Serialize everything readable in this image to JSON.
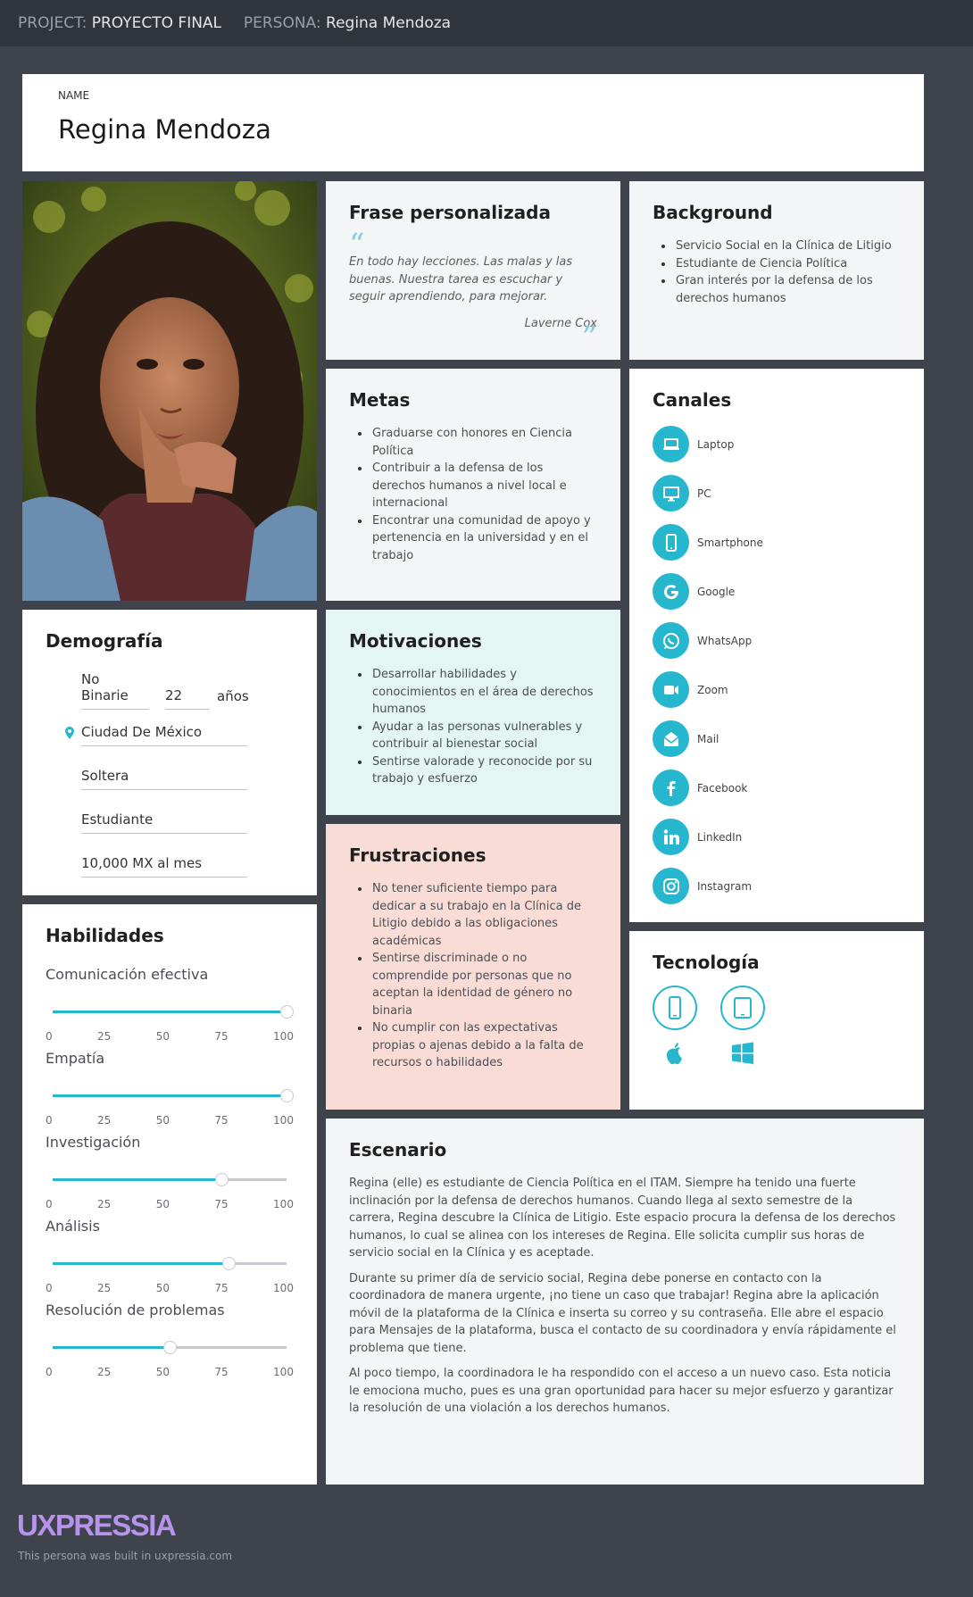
{
  "header": {
    "project_label": "PROJECT:",
    "project_value": "PROYECTO FINAL",
    "persona_label": "PERSONA:",
    "persona_value": "Regina Mendoza"
  },
  "name_card": {
    "label": "NAME",
    "name": "Regina Mendoza"
  },
  "quote_card": {
    "title": "Frase personalizada",
    "text": "En todo hay lecciones. Las malas y las buenas. Nuestra tarea es escuchar y seguir aprendiendo, para mejorar.",
    "author": "Laverne Cox"
  },
  "background": {
    "title": "Background",
    "items": [
      "Servicio Social en la Clínica de Litigio",
      "Estudiante de Ciencia Política",
      "Gran interés por la defensa de los derechos humanos"
    ]
  },
  "goals": {
    "title": "Metas",
    "items": [
      "Graduarse con honores en Ciencia Política",
      "Contribuir a la defensa de los derechos humanos a nivel local e internacional",
      "Encontrar una comunidad de apoyo y pertenencia en la universidad y en el trabajo"
    ]
  },
  "channels": {
    "title": "Canales",
    "items": [
      {
        "label": "Laptop",
        "icon": "laptop-icon"
      },
      {
        "label": "PC",
        "icon": "desktop-icon"
      },
      {
        "label": "Smartphone",
        "icon": "smartphone-icon"
      },
      {
        "label": "Google",
        "icon": "google-icon"
      },
      {
        "label": "WhatsApp",
        "icon": "whatsapp-icon"
      },
      {
        "label": "Zoom",
        "icon": "zoom-icon"
      },
      {
        "label": "Mail",
        "icon": "mail-icon"
      },
      {
        "label": "Facebook",
        "icon": "facebook-icon"
      },
      {
        "label": "LinkedIn",
        "icon": "linkedin-icon"
      },
      {
        "label": "Instagram",
        "icon": "instagram-icon"
      }
    ]
  },
  "demographics": {
    "title": "Demografía",
    "gender": "No Binarie",
    "age": "22",
    "age_unit": "años",
    "location": "Ciudad De México",
    "status": "Soltera",
    "occupation": "Estudiante",
    "income": "10,000 MX al mes"
  },
  "motivations": {
    "title": "Motivaciones",
    "items": [
      "Desarrollar habilidades y conocimientos en el área de derechos humanos",
      "Ayudar a las personas vulnerables y contribuir al bienestar social",
      "Sentirse valorade y reconocide por su trabajo y esfuerzo"
    ]
  },
  "frustrations": {
    "title": "Frustraciones",
    "items": [
      "No tener suficiente tiempo para dedicar a su trabajo en la Clínica de Litigio debido a las obligaciones académicas",
      "Sentirse discriminade o no comprendide por personas que no aceptan la identidad de género no binaria",
      "No cumplir con las expectativas propias o ajenas debido a la falta de recursos o habilidades"
    ]
  },
  "skills": {
    "title": "Habilidades",
    "tick_labels": [
      "0",
      "25",
      "50",
      "75",
      "100"
    ],
    "items": [
      {
        "name": "Comunicación efectiva",
        "value": 100
      },
      {
        "name": "Empatía",
        "value": 100
      },
      {
        "name": "Investigación",
        "value": 72
      },
      {
        "name": "Análisis",
        "value": 75
      },
      {
        "name": "Resolución de problemas",
        "value": 50
      }
    ]
  },
  "technology": {
    "title": "Tecnología",
    "items": [
      {
        "device": "smartphone-icon",
        "os": "apple-icon"
      },
      {
        "device": "tablet-icon",
        "os": "windows-icon"
      }
    ]
  },
  "scenario": {
    "title": "Escenario",
    "paragraphs": [
      "Regina (elle) es estudiante de Ciencia Política en el ITAM. Siempre ha tenido una fuerte inclinación por la defensa de derechos humanos. Cuando llega al sexto semestre de la carrera, Regina descubre la Clínica de Litigio. Este espacio procura la defensa de los derechos humanos, lo cual se alinea con los intereses de Regina. Elle solicita cumplir sus horas de servicio social en la Clínica y es aceptade.",
      "Durante su primer día de servicio social, Regina debe ponerse en contacto con la coordinadora de manera urgente, ¡no tiene un caso que trabajar! Regina abre la aplicación móvil de la plataforma de la Clínica e inserta su correo y su contraseña. Elle abre el espacio para Mensajes de la plataforma, busca el contacto de su coordinadora y envía rápidamente el problema que tiene.",
      "Al poco tiempo, la coordinadora le ha respondido con el acceso a un nuevo caso. Esta noticia le emociona mucho, pues es una gran oportunidad para hacer su mejor esfuerzo y garantizar la resolución de una violación a los derechos humanos."
    ]
  },
  "footer": {
    "logo": "UXPRESSIA",
    "built_by": "This persona was built in uxpressia.com"
  },
  "colors": {
    "accent": "#26b6cd",
    "motivations_bg": "#e3f6f3",
    "frustrations_bg": "#f9dcd6",
    "logo": "#b793ee"
  }
}
